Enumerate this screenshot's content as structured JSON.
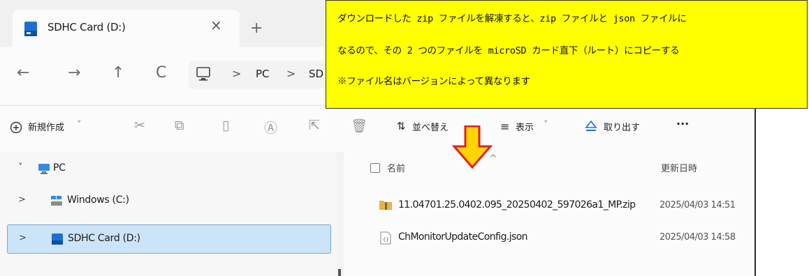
{
  "tab": {
    "title": "SDHC Card (D:)",
    "close_glyph": "×",
    "new_tab_glyph": "+"
  },
  "nav": {
    "back": "←",
    "forward": "→",
    "up": "↑",
    "refresh": "C",
    "breadcrumb": [
      "PC",
      "SD"
    ],
    "separator": ">"
  },
  "toolbar": {
    "new_label": "新規作成",
    "new_chevron": "˅",
    "sort_label": "並べ替え",
    "view_label": "表示",
    "view_chevron": "˅",
    "eject_label": "取り出す",
    "more_label": "···"
  },
  "tree": [
    {
      "label": "PC",
      "icon": "monitor-icon",
      "chevron": "˅",
      "selected": false
    },
    {
      "label": "Windows (C:)",
      "icon": "windows-drive-icon",
      "chevron": ">",
      "selected": false
    },
    {
      "label": "SDHC Card (D:)",
      "icon": "sd-card-icon",
      "chevron": ">",
      "selected": true
    }
  ],
  "columns": {
    "name": "名前",
    "date": "更新日時",
    "sort_caret": "^"
  },
  "files": [
    {
      "name": "11.04701.25.0402.095_20250402_597026a1_MP.zip",
      "date": "2025/04/03 14:51",
      "icon": "zip-folder-icon"
    },
    {
      "name": "ChMonitorUpdateConfig.json",
      "date": "2025/04/03 14:58",
      "icon": "json-file-icon"
    }
  ],
  "note": {
    "line1": "ダウンロードした zip ファイルを解凍すると、zip ファイルと json ファイルに",
    "line2": "なるので、その 2 つのファイルを microSD カード直下（ルート）にコピーする",
    "line3": "※ファイル名はバージョンによって異なります"
  },
  "colors": {
    "note_background": "#ffff00",
    "arrow_fill": "#ffd400",
    "arrow_stroke": "#e02020",
    "selection": "#cce4f7"
  }
}
